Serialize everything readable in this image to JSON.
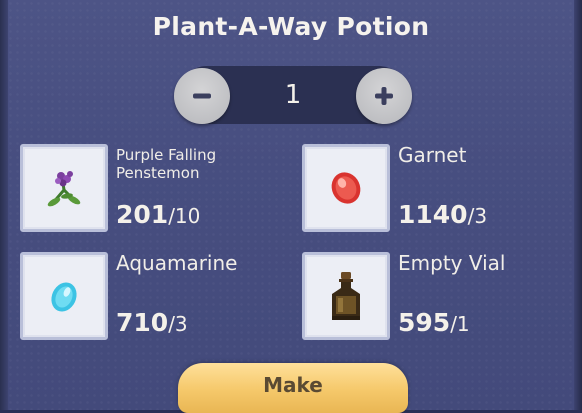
{
  "title": "Plant-A-Way Potion",
  "quantity": {
    "value": "1",
    "decrease_icon": "minus-icon",
    "increase_icon": "plus-icon"
  },
  "ingredients": [
    {
      "name": "Purple Falling Penstemon",
      "have": "201",
      "need": "/10",
      "icon": "purple-flower-icon"
    },
    {
      "name": "Garnet",
      "have": "1140",
      "need": "/3",
      "icon": "red-gem-icon"
    },
    {
      "name": "Aquamarine",
      "have": "710",
      "need": "/3",
      "icon": "blue-gem-icon"
    },
    {
      "name": "Empty Vial",
      "have": "595",
      "need": "/1",
      "icon": "vial-icon"
    }
  ],
  "make_button": {
    "label": "Make"
  },
  "colors": {
    "panel": "#4a5182",
    "make_button": "#f7cd71",
    "stepper": "#2b3052"
  }
}
